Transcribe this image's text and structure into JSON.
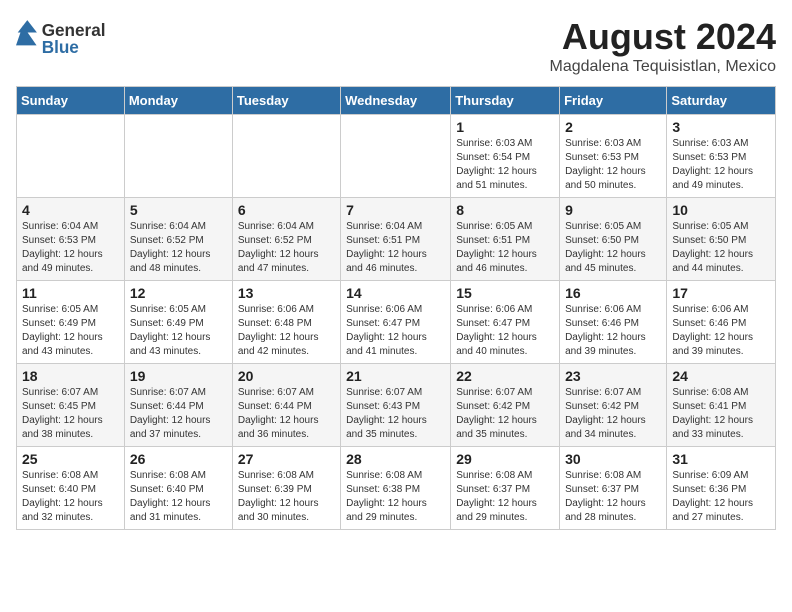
{
  "header": {
    "logo_general": "General",
    "logo_blue": "Blue",
    "month": "August 2024",
    "location": "Magdalena Tequisistlan, Mexico"
  },
  "weekdays": [
    "Sunday",
    "Monday",
    "Tuesday",
    "Wednesday",
    "Thursday",
    "Friday",
    "Saturday"
  ],
  "weeks": [
    [
      {
        "day": "",
        "detail": ""
      },
      {
        "day": "",
        "detail": ""
      },
      {
        "day": "",
        "detail": ""
      },
      {
        "day": "",
        "detail": ""
      },
      {
        "day": "1",
        "detail": "Sunrise: 6:03 AM\nSunset: 6:54 PM\nDaylight: 12 hours\nand 51 minutes."
      },
      {
        "day": "2",
        "detail": "Sunrise: 6:03 AM\nSunset: 6:53 PM\nDaylight: 12 hours\nand 50 minutes."
      },
      {
        "day": "3",
        "detail": "Sunrise: 6:03 AM\nSunset: 6:53 PM\nDaylight: 12 hours\nand 49 minutes."
      }
    ],
    [
      {
        "day": "4",
        "detail": "Sunrise: 6:04 AM\nSunset: 6:53 PM\nDaylight: 12 hours\nand 49 minutes."
      },
      {
        "day": "5",
        "detail": "Sunrise: 6:04 AM\nSunset: 6:52 PM\nDaylight: 12 hours\nand 48 minutes."
      },
      {
        "day": "6",
        "detail": "Sunrise: 6:04 AM\nSunset: 6:52 PM\nDaylight: 12 hours\nand 47 minutes."
      },
      {
        "day": "7",
        "detail": "Sunrise: 6:04 AM\nSunset: 6:51 PM\nDaylight: 12 hours\nand 46 minutes."
      },
      {
        "day": "8",
        "detail": "Sunrise: 6:05 AM\nSunset: 6:51 PM\nDaylight: 12 hours\nand 46 minutes."
      },
      {
        "day": "9",
        "detail": "Sunrise: 6:05 AM\nSunset: 6:50 PM\nDaylight: 12 hours\nand 45 minutes."
      },
      {
        "day": "10",
        "detail": "Sunrise: 6:05 AM\nSunset: 6:50 PM\nDaylight: 12 hours\nand 44 minutes."
      }
    ],
    [
      {
        "day": "11",
        "detail": "Sunrise: 6:05 AM\nSunset: 6:49 PM\nDaylight: 12 hours\nand 43 minutes."
      },
      {
        "day": "12",
        "detail": "Sunrise: 6:05 AM\nSunset: 6:49 PM\nDaylight: 12 hours\nand 43 minutes."
      },
      {
        "day": "13",
        "detail": "Sunrise: 6:06 AM\nSunset: 6:48 PM\nDaylight: 12 hours\nand 42 minutes."
      },
      {
        "day": "14",
        "detail": "Sunrise: 6:06 AM\nSunset: 6:47 PM\nDaylight: 12 hours\nand 41 minutes."
      },
      {
        "day": "15",
        "detail": "Sunrise: 6:06 AM\nSunset: 6:47 PM\nDaylight: 12 hours\nand 40 minutes."
      },
      {
        "day": "16",
        "detail": "Sunrise: 6:06 AM\nSunset: 6:46 PM\nDaylight: 12 hours\nand 39 minutes."
      },
      {
        "day": "17",
        "detail": "Sunrise: 6:06 AM\nSunset: 6:46 PM\nDaylight: 12 hours\nand 39 minutes."
      }
    ],
    [
      {
        "day": "18",
        "detail": "Sunrise: 6:07 AM\nSunset: 6:45 PM\nDaylight: 12 hours\nand 38 minutes."
      },
      {
        "day": "19",
        "detail": "Sunrise: 6:07 AM\nSunset: 6:44 PM\nDaylight: 12 hours\nand 37 minutes."
      },
      {
        "day": "20",
        "detail": "Sunrise: 6:07 AM\nSunset: 6:44 PM\nDaylight: 12 hours\nand 36 minutes."
      },
      {
        "day": "21",
        "detail": "Sunrise: 6:07 AM\nSunset: 6:43 PM\nDaylight: 12 hours\nand 35 minutes."
      },
      {
        "day": "22",
        "detail": "Sunrise: 6:07 AM\nSunset: 6:42 PM\nDaylight: 12 hours\nand 35 minutes."
      },
      {
        "day": "23",
        "detail": "Sunrise: 6:07 AM\nSunset: 6:42 PM\nDaylight: 12 hours\nand 34 minutes."
      },
      {
        "day": "24",
        "detail": "Sunrise: 6:08 AM\nSunset: 6:41 PM\nDaylight: 12 hours\nand 33 minutes."
      }
    ],
    [
      {
        "day": "25",
        "detail": "Sunrise: 6:08 AM\nSunset: 6:40 PM\nDaylight: 12 hours\nand 32 minutes."
      },
      {
        "day": "26",
        "detail": "Sunrise: 6:08 AM\nSunset: 6:40 PM\nDaylight: 12 hours\nand 31 minutes."
      },
      {
        "day": "27",
        "detail": "Sunrise: 6:08 AM\nSunset: 6:39 PM\nDaylight: 12 hours\nand 30 minutes."
      },
      {
        "day": "28",
        "detail": "Sunrise: 6:08 AM\nSunset: 6:38 PM\nDaylight: 12 hours\nand 29 minutes."
      },
      {
        "day": "29",
        "detail": "Sunrise: 6:08 AM\nSunset: 6:37 PM\nDaylight: 12 hours\nand 29 minutes."
      },
      {
        "day": "30",
        "detail": "Sunrise: 6:08 AM\nSunset: 6:37 PM\nDaylight: 12 hours\nand 28 minutes."
      },
      {
        "day": "31",
        "detail": "Sunrise: 6:09 AM\nSunset: 6:36 PM\nDaylight: 12 hours\nand 27 minutes."
      }
    ]
  ]
}
